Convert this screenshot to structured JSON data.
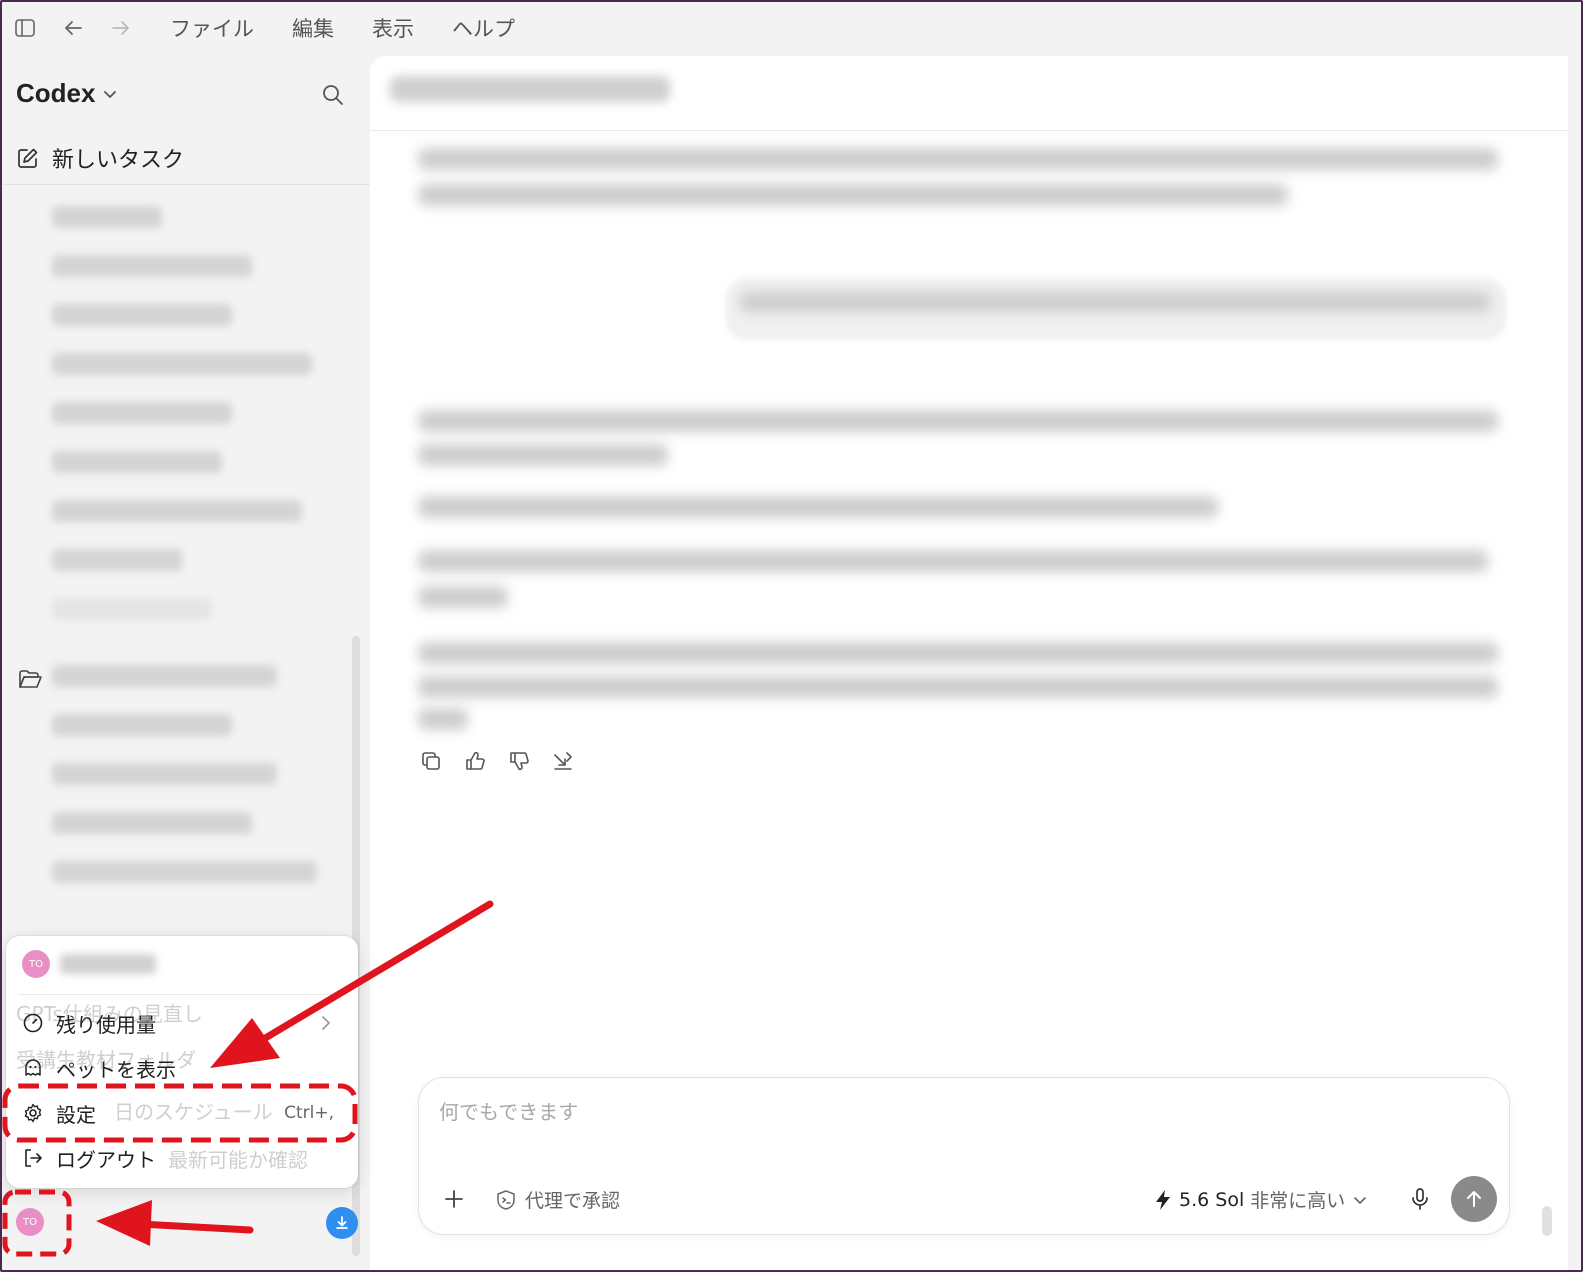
{
  "menubar": {
    "items": [
      "ファイル",
      "編集",
      "表示",
      "ヘルプ"
    ]
  },
  "sidebar": {
    "brand": "Codex",
    "new_task_label": "新しいタスク"
  },
  "popup": {
    "avatar_initials": "TO",
    "items": [
      {
        "label": "残り使用量",
        "icon": "gauge-icon"
      },
      {
        "label": "ペットを表示",
        "icon": "pet-icon"
      },
      {
        "label": "設定",
        "icon": "gear-icon",
        "shortcut": "Ctrl+,"
      },
      {
        "label": "ログアウト",
        "icon": "logout-icon"
      }
    ],
    "underlying_threads": [
      "GPTs仕組みの見直し",
      "受講生教材フォルダ",
      "日のスケジュール",
      "最新可能か確認"
    ]
  },
  "account": {
    "avatar_initials": "TO"
  },
  "composer": {
    "placeholder": "何でもできます",
    "approval_label": "代理で承認",
    "model_name": "5.6 Sol",
    "effort_label": "非常に高い"
  },
  "colors": {
    "accent_blue": "#2f8ff0",
    "avatar_pink": "#e98fc6",
    "annotation_red": "#e0141c",
    "send_gray": "#8a8a8a"
  }
}
